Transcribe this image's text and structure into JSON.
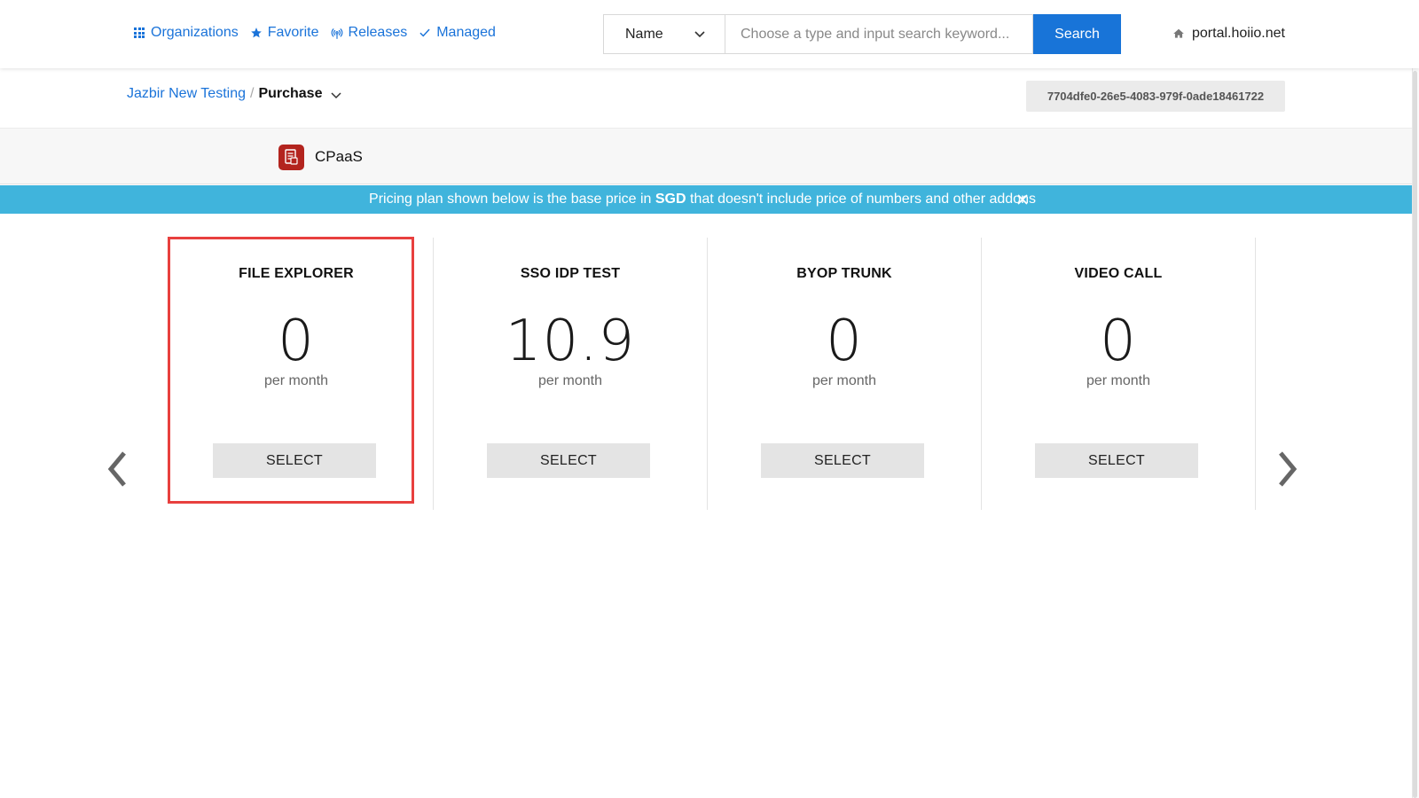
{
  "nav": {
    "items": [
      {
        "label": "Organizations",
        "icon": "grid-icon"
      },
      {
        "label": "Favorite",
        "icon": "star-icon"
      },
      {
        "label": "Releases",
        "icon": "broadcast-icon"
      },
      {
        "label": "Managed",
        "icon": "check-icon"
      }
    ]
  },
  "search": {
    "type_selected": "Name",
    "placeholder": "Choose a type and input search keyword...",
    "button_label": "Search"
  },
  "portal": {
    "domain": "portal.hoiio.net"
  },
  "breadcrumb": {
    "parent": "Jazbir New Testing",
    "separator": "/",
    "current": "Purchase"
  },
  "uuid": "7704dfe0-26e5-4083-979f-0ade18461722",
  "product": {
    "name": "CPaaS"
  },
  "banner": {
    "text_before": "Pricing plan shown below is the base price in ",
    "currency": "SGD",
    "text_after": " that doesn't include price of numbers and other addons"
  },
  "plans": [
    {
      "title": "FILE EXPLORER",
      "price": "0",
      "unit": "per month",
      "button": "SELECT"
    },
    {
      "title": "SSO IDP TEST",
      "price": "10.9",
      "unit": "per month",
      "button": "SELECT"
    },
    {
      "title": "BYOP TRUNK",
      "price": "0",
      "unit": "per month",
      "button": "SELECT"
    },
    {
      "title": "VIDEO CALL",
      "price": "0",
      "unit": "per month",
      "button": "SELECT"
    }
  ],
  "colors": {
    "accent": "#1874d8",
    "banner": "#40b4dc",
    "highlight": "#e8403e",
    "product_icon": "#b3241e"
  }
}
